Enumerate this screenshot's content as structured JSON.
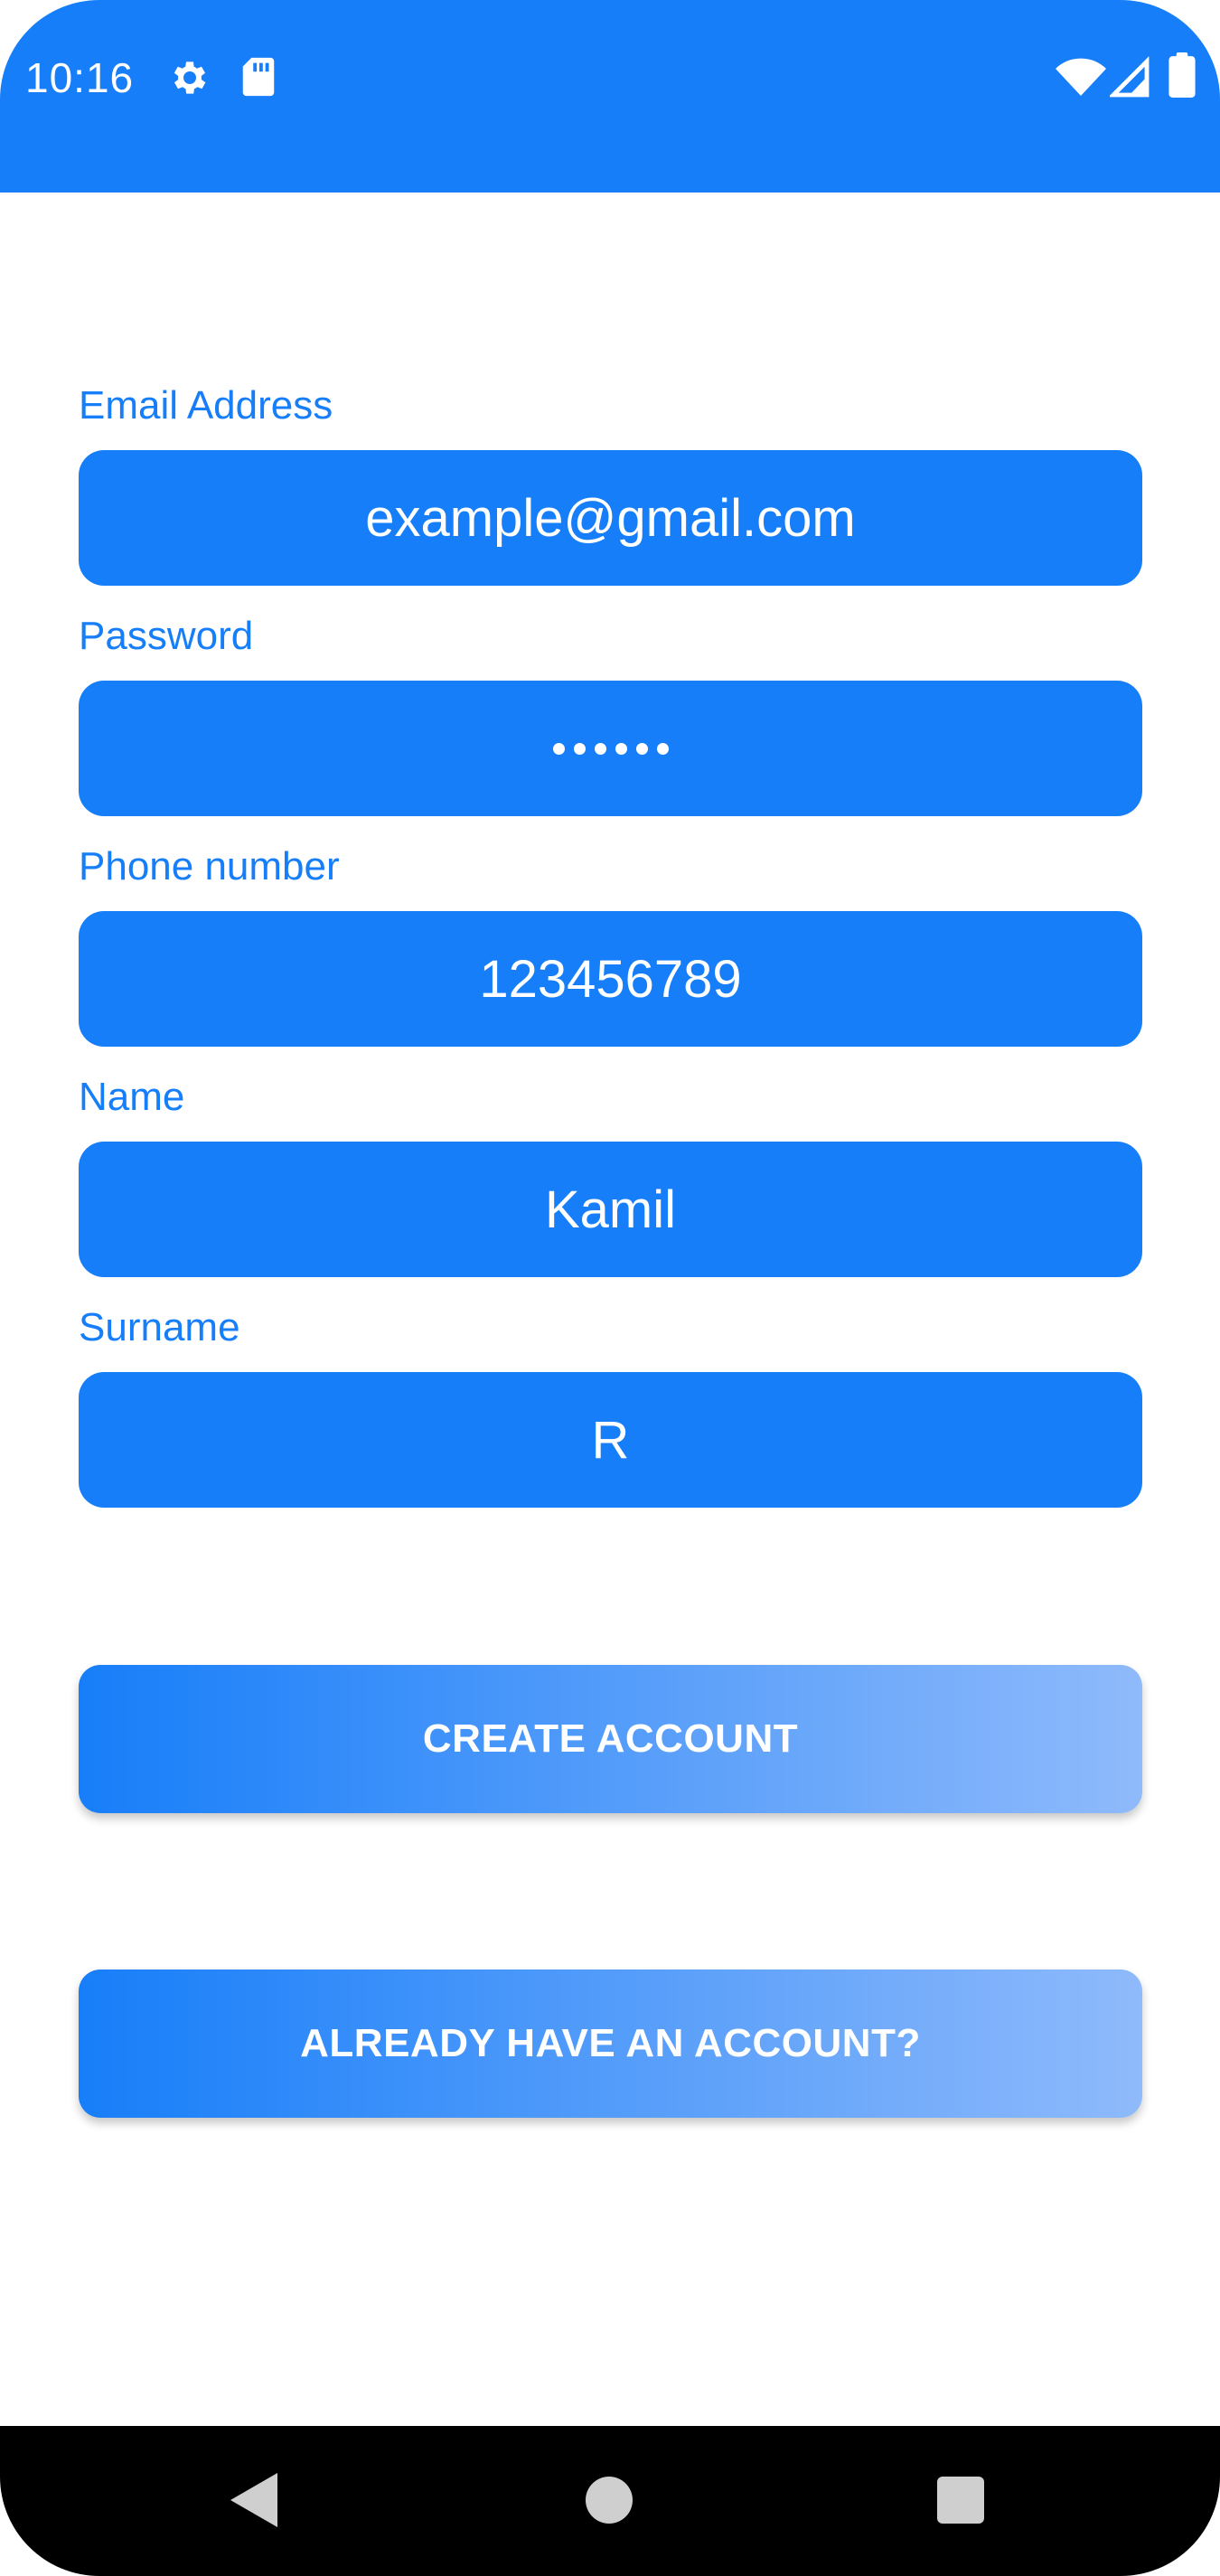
{
  "status_bar": {
    "time": "10:16",
    "icons": [
      "gear-icon",
      "sd-card-icon",
      "wifi-icon",
      "signal-icon",
      "battery-icon"
    ]
  },
  "colors": {
    "accent": "#177ef9",
    "gradient_end": "#8fbafb",
    "nav_bar": "#000000"
  },
  "form": {
    "email": {
      "label": "Email Address",
      "value": "example@gmail.com"
    },
    "password": {
      "label": "Password",
      "value": "••••••"
    },
    "phone": {
      "label": "Phone number",
      "value": "123456789"
    },
    "name": {
      "label": "Name",
      "value": "Kamil"
    },
    "surname": {
      "label": "Surname",
      "value": "R"
    }
  },
  "buttons": {
    "create_account": "CREATE ACCOUNT",
    "already_have_account": "ALREADY HAVE AN ACCOUNT?"
  },
  "nav_bar": {
    "icons": [
      "back-icon",
      "home-icon",
      "recents-icon"
    ]
  }
}
